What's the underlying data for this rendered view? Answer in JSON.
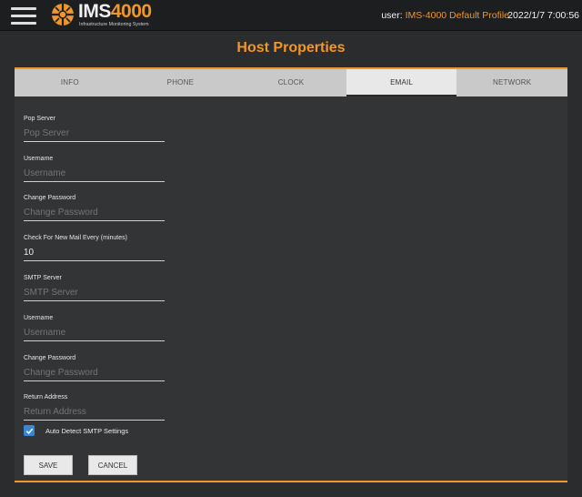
{
  "header": {
    "logo_text": "IMS",
    "logo_number": "4000",
    "logo_subtitle": "Infrastructure Monitoring System",
    "user_prefix": "user:",
    "user_name": "IMS-4000 Default Profile",
    "datetime": "2022/1/7 7:00:56"
  },
  "page": {
    "title": "Host Properties"
  },
  "tabs": [
    {
      "label": "INFO",
      "active": false
    },
    {
      "label": "PHONE",
      "active": false
    },
    {
      "label": "CLOCK",
      "active": false
    },
    {
      "label": "EMAIL",
      "active": true
    },
    {
      "label": "NETWORK",
      "active": false
    }
  ],
  "fields": [
    {
      "label": "Pop Server",
      "value": "",
      "placeholder": "Pop Server"
    },
    {
      "label": "Username",
      "value": "",
      "placeholder": "Username"
    },
    {
      "label": "Change Password",
      "value": "",
      "placeholder": "Change Password"
    },
    {
      "label": "Check For New Mail Every (minutes)",
      "value": "10",
      "placeholder": ""
    },
    {
      "label": "SMTP Server",
      "value": "",
      "placeholder": "SMTP Server"
    },
    {
      "label": "Username",
      "value": "",
      "placeholder": "Username"
    },
    {
      "label": "Change Password",
      "value": "",
      "placeholder": "Change Password"
    },
    {
      "label": "Return Address",
      "value": "",
      "placeholder": "Return Address"
    }
  ],
  "auto_detect": {
    "label": "Auto Detect SMTP Settings",
    "checked": true
  },
  "buttons": {
    "save": "SAVE",
    "cancel": "CANCEL"
  },
  "colors": {
    "accent": "#f0962a",
    "checkbox": "#3a86d6",
    "background": "#2b2c2e"
  }
}
